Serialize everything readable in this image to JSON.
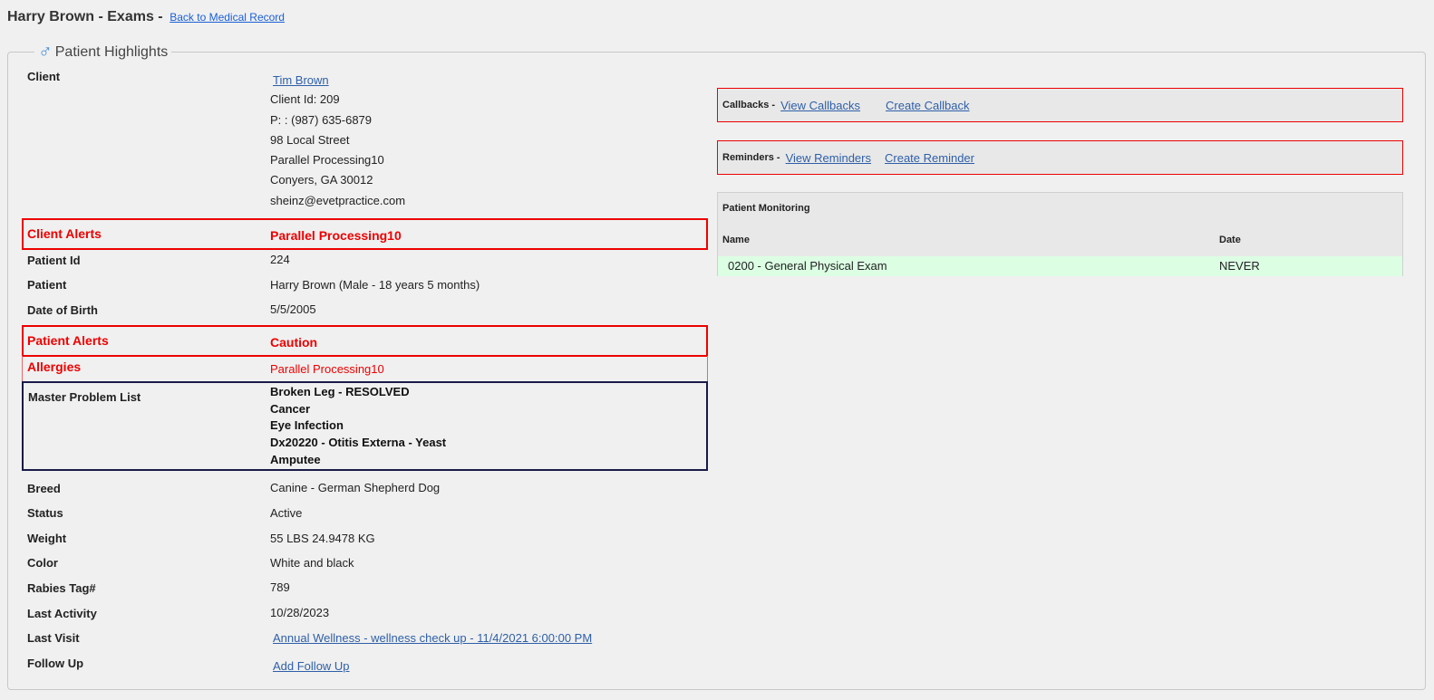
{
  "header": {
    "title": "Harry Brown - Exams -",
    "back_link": "Back to Medical Record"
  },
  "highlights": {
    "legend": "Patient Highlights",
    "legend_icon": "male-icon",
    "client": {
      "label": "Client",
      "name": "Tim Brown",
      "client_id": "Client Id: 209",
      "phone": "P: : (987) 635-6879",
      "address1": "98 Local Street",
      "address2": "Parallel Processing10",
      "city": "Conyers, GA 30012",
      "email": "sheinz@evetpractice.com"
    },
    "client_alerts": {
      "label": "Client Alerts",
      "value": "Parallel Processing10"
    },
    "patient_id": {
      "label": "Patient Id",
      "value": "224"
    },
    "patient": {
      "label": "Patient",
      "value": "Harry Brown (Male - 18 years 5 months)"
    },
    "dob": {
      "label": "Date of Birth",
      "value": "5/5/2005"
    },
    "patient_alerts": {
      "label": "Patient Alerts",
      "value": "Caution"
    },
    "allergies": {
      "label": "Allergies",
      "value": "Parallel Processing10"
    },
    "master_problem_list": {
      "label": "Master Problem List",
      "items": [
        "Broken Leg - RESOLVED",
        "Cancer",
        "Eye Infection",
        "Dx20220 - Otitis Externa - Yeast",
        "Amputee"
      ]
    },
    "breed": {
      "label": "Breed",
      "value": "Canine - German Shepherd Dog"
    },
    "status": {
      "label": "Status",
      "value": "Active"
    },
    "weight": {
      "label": "Weight",
      "value": "55 LBS 24.9478 KG"
    },
    "color": {
      "label": "Color",
      "value": "White and black"
    },
    "rabies": {
      "label": "Rabies Tag#",
      "value": "789"
    },
    "last_activity": {
      "label": "Last Activity",
      "value": "10/28/2023"
    },
    "last_visit": {
      "label": "Last Visit",
      "value": "Annual Wellness - wellness check up - 11/4/2021 6:00:00 PM"
    },
    "follow_up": {
      "label": "Follow Up",
      "value": "Add Follow Up"
    }
  },
  "callbacks": {
    "title": "Callbacks -",
    "view": "View Callbacks",
    "create": "Create Callback"
  },
  "reminders": {
    "title": "Reminders -",
    "view": "View Reminders",
    "create": "Create Reminder"
  },
  "monitoring": {
    "title": "Patient Monitoring",
    "col_name": "Name",
    "col_date": "Date",
    "rows": [
      {
        "name": "0200 - General Physical Exam",
        "date": "NEVER"
      }
    ]
  },
  "colors": {
    "alert_red": "#ee0000",
    "link_blue": "#2e5fa8",
    "monitor_row_green": "#dcffe4",
    "problem_border": "#1a1a4a"
  }
}
